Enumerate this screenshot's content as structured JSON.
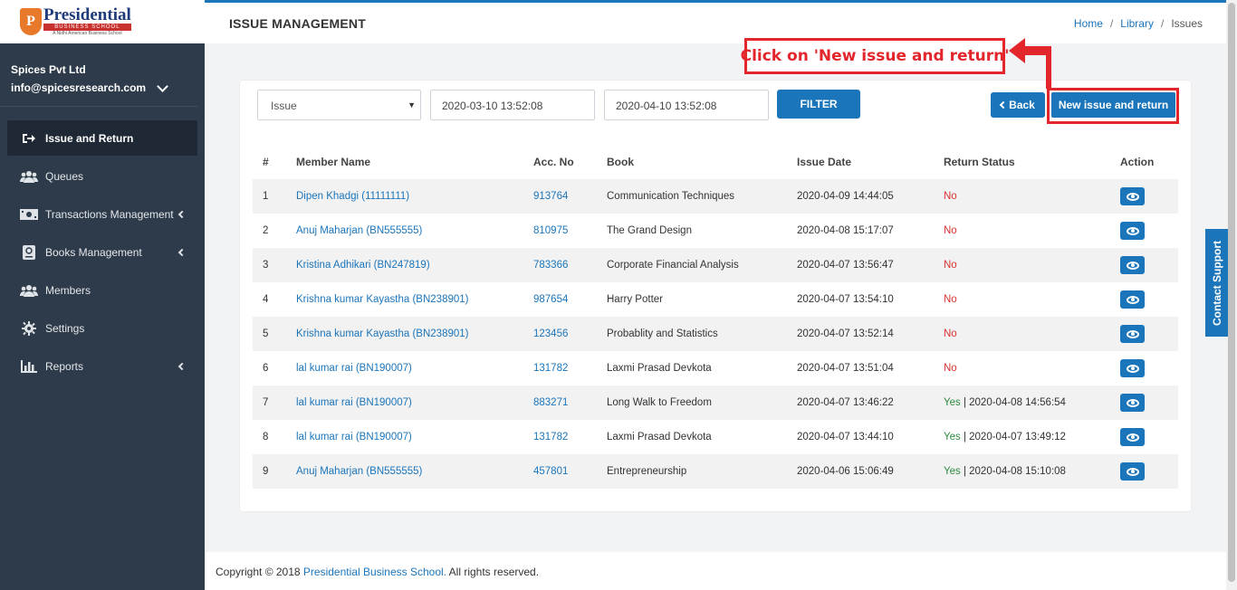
{
  "brand": {
    "logo_letter": "P",
    "name": "Presidential",
    "subtitle": "BUSINESS SCHOOL",
    "tagline": "A Nidhi American Business School"
  },
  "account": {
    "company": "Spices Pvt Ltd",
    "email": "info@spicesresearch.com"
  },
  "menu": [
    {
      "label": "Issue and Return",
      "icon": "sign-out-icon",
      "active": true
    },
    {
      "label": "Queues",
      "icon": "users-icon"
    },
    {
      "label": "Transactions Management",
      "icon": "money-icon",
      "has_submenu": true
    },
    {
      "label": "Books Management",
      "icon": "book-icon",
      "has_submenu": true
    },
    {
      "label": "Members",
      "icon": "users-icon"
    },
    {
      "label": "Settings",
      "icon": "gear-icon"
    },
    {
      "label": "Reports",
      "icon": "bar-chart-icon",
      "has_submenu": true
    }
  ],
  "header": {
    "title": "ISSUE MANAGEMENT",
    "breadcrumb": [
      "Home",
      "Library",
      "Issues"
    ]
  },
  "filters": {
    "type_selected": "Issue",
    "from_date": "2020-03-10 13:52:08",
    "to_date": "2020-04-10 13:52:08",
    "filter_label": "FILTER"
  },
  "actions": {
    "back_label": "Back",
    "new_label": "New issue and return"
  },
  "annotation": {
    "text": "Click on 'New issue and return'",
    "color": "#e2262c"
  },
  "table": {
    "columns": [
      "#",
      "Member Name",
      "Acc. No",
      "Book",
      "Issue Date",
      "Return Status",
      "Action"
    ],
    "rows": [
      {
        "num": "1",
        "member": "Dipen Khadgi (11111111)",
        "acc": "913764",
        "book": "Communication Techniques",
        "issue_date": "2020-04-09 14:44:05",
        "status": "No",
        "return_date": ""
      },
      {
        "num": "2",
        "member": "Anuj Maharjan (BN555555)",
        "acc": "810975",
        "book": "The Grand Design",
        "issue_date": "2020-04-08 15:17:07",
        "status": "No",
        "return_date": ""
      },
      {
        "num": "3",
        "member": "Kristina Adhikari (BN247819)",
        "acc": "783366",
        "book": "Corporate Financial Analysis",
        "issue_date": "2020-04-07 13:56:47",
        "status": "No",
        "return_date": ""
      },
      {
        "num": "4",
        "member": "Krishna kumar Kayastha (BN238901)",
        "acc": "987654",
        "book": "Harry Potter",
        "issue_date": "2020-04-07 13:54:10",
        "status": "No",
        "return_date": ""
      },
      {
        "num": "5",
        "member": "Krishna kumar Kayastha (BN238901)",
        "acc": "123456",
        "book": "Probablity and Statistics",
        "issue_date": "2020-04-07 13:52:14",
        "status": "No",
        "return_date": ""
      },
      {
        "num": "6",
        "member": "lal kumar rai (BN190007)",
        "acc": "131782",
        "book": "Laxmi Prasad Devkota",
        "issue_date": "2020-04-07 13:51:04",
        "status": "No",
        "return_date": ""
      },
      {
        "num": "7",
        "member": "lal kumar rai (BN190007)",
        "acc": "883271",
        "book": "Long Walk to Freedom",
        "issue_date": "2020-04-07 13:46:22",
        "status": "Yes",
        "return_date": " | 2020-04-08 14:56:54"
      },
      {
        "num": "8",
        "member": "lal kumar rai (BN190007)",
        "acc": "131782",
        "book": "Laxmi Prasad Devkota",
        "issue_date": "2020-04-07 13:44:10",
        "status": "Yes",
        "return_date": " | 2020-04-07 13:49:12"
      },
      {
        "num": "9",
        "member": "Anuj Maharjan (BN555555)",
        "acc": "457801",
        "book": "Entrepreneurship",
        "issue_date": "2020-04-06 15:06:49",
        "status": "Yes",
        "return_date": " | 2020-04-08 15:10:08"
      }
    ]
  },
  "contact_support": "Contact Support",
  "footer": {
    "prefix": "Copyright © 2018 ",
    "brand": "Presidential Business School.",
    "suffix": " All rights reserved."
  },
  "colors": {
    "primary": "#1b75bb",
    "sidebar": "#2e3b4a",
    "status_no": "#d9332f",
    "status_yes": "#2e8b3e"
  }
}
